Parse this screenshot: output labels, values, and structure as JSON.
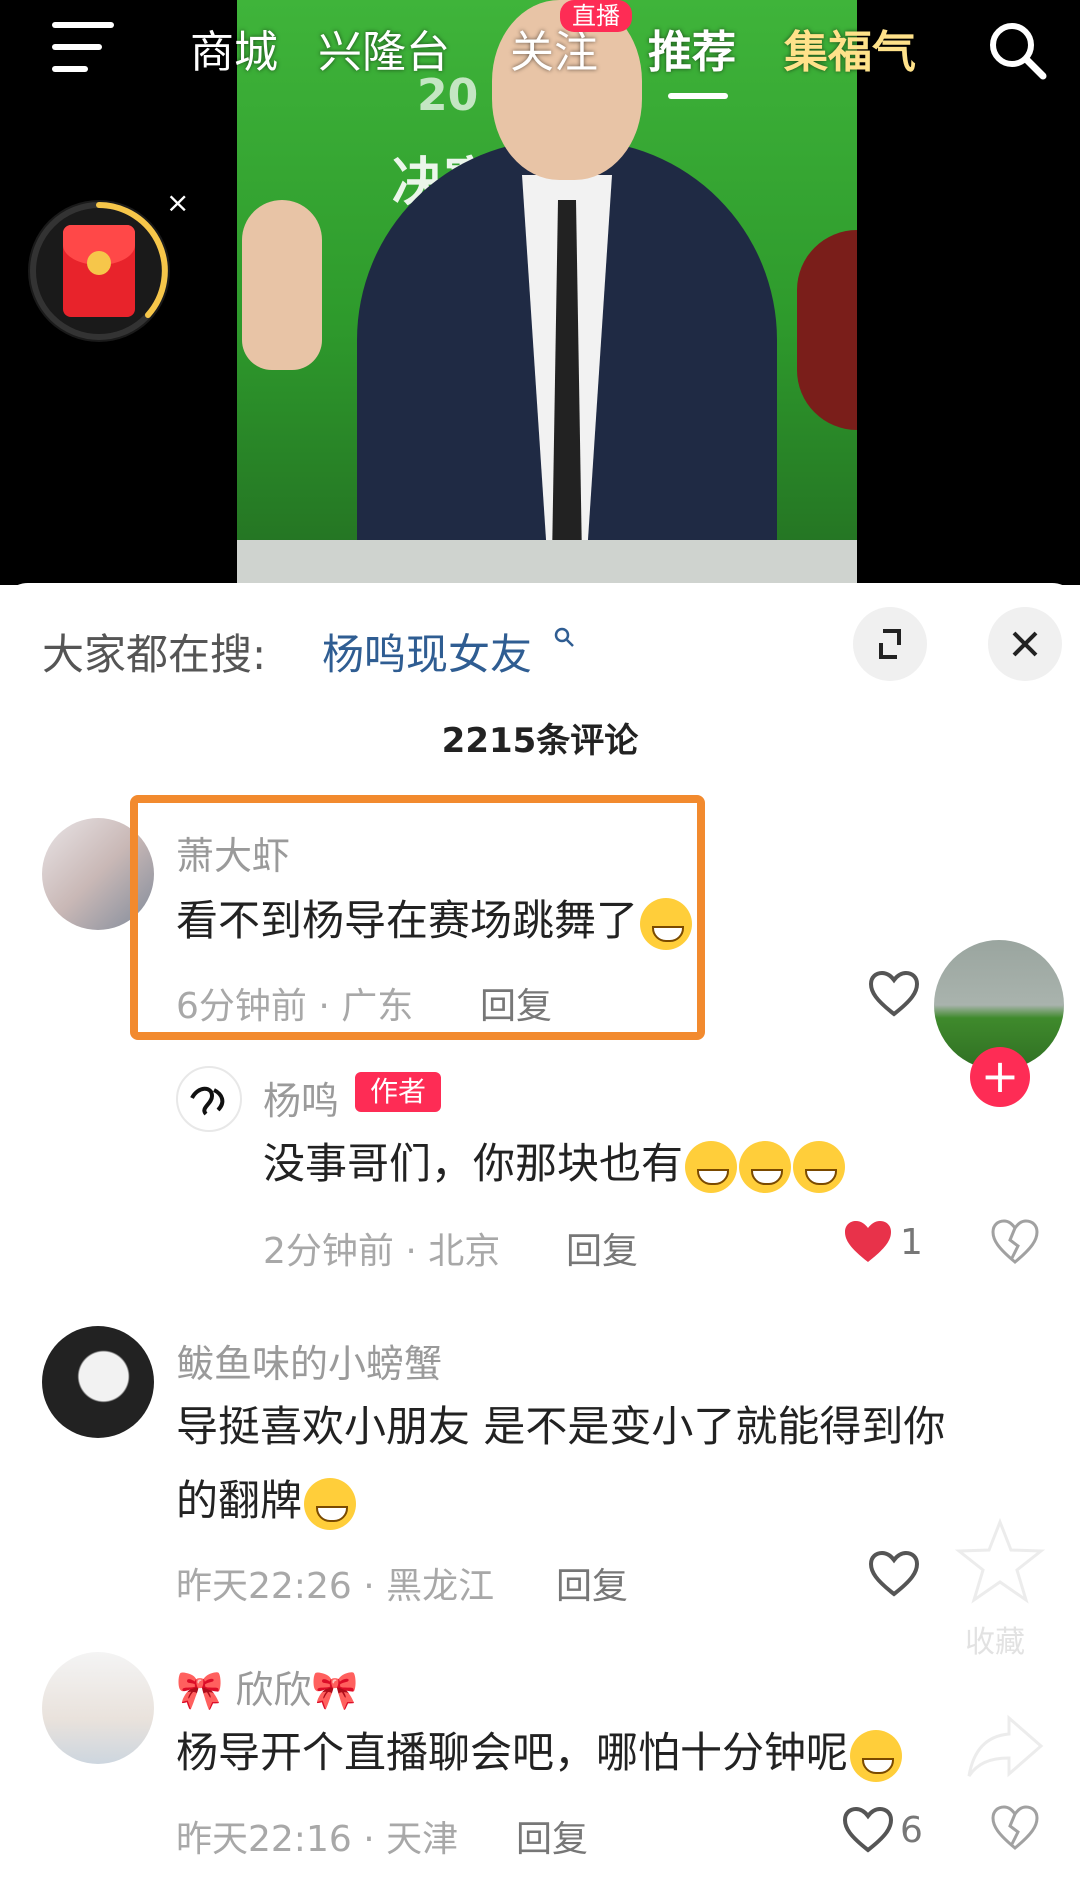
{
  "nav": {
    "items": [
      "商城",
      "兴隆台",
      "关注",
      "推荐",
      "集福气"
    ],
    "live_badge": "直播",
    "active": "推荐"
  },
  "video": {
    "stage_text": "决赛",
    "stage_sub": "20",
    "redpacket_close": "×"
  },
  "comments_panel": {
    "hot_search_label": "大家都在搜:",
    "hot_search_term": "杨鸣现女友",
    "count_label": "2215条评论",
    "reply_label": "回复"
  },
  "comments": [
    {
      "user": "萧大虾",
      "text": "看不到杨导在赛场跳舞了",
      "time": "6分钟前 · 广东",
      "likes": ""
    },
    {
      "user": "杨鸣",
      "badge": "作者",
      "text": "没事哥们，你那块也有",
      "time": "2分钟前 · 北京",
      "likes": "1"
    },
    {
      "user": "鲅鱼味的小螃蟹",
      "text_line1": "导挺喜欢小朋友 是不是变小了就能得到你",
      "text_line2": "的翻牌",
      "time": "昨天22:26 · 黑龙江",
      "likes": ""
    },
    {
      "user": "🎀 欣欣🎀",
      "text": "杨导开个直播聊会吧，哪怕十分钟呢",
      "time": "昨天22:16 · 天津",
      "likes": "6"
    }
  ],
  "side_actions": {
    "favorite_label": "收藏"
  },
  "colors": {
    "accent": "#fe2c55",
    "highlight_box": "#f28a2e",
    "link_blue": "#2f5d92"
  }
}
